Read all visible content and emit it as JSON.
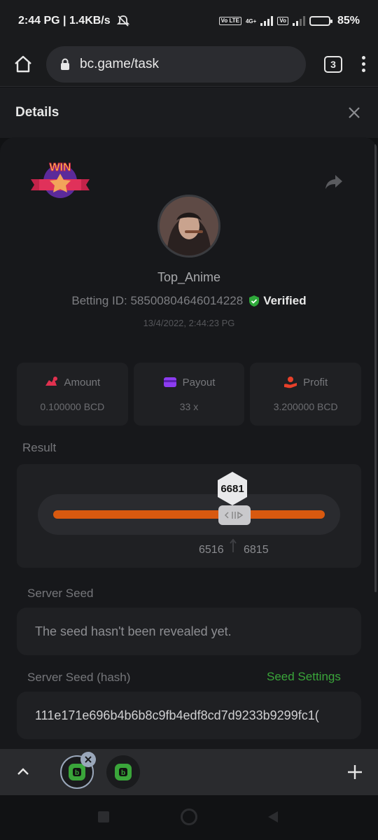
{
  "status": {
    "time_speed": "2:44 PG | 1.4KB/s",
    "net_tag_1": "Vo LTE",
    "net_tag_2": "4G+",
    "battery": "85%"
  },
  "browser": {
    "url": "bc.game/task",
    "tab_count": "3"
  },
  "header": {
    "title": "Details"
  },
  "bet": {
    "badge": "WIN",
    "username": "Top_Anime",
    "betting_id": "Betting ID: 58500804646014228",
    "verified": "Verified",
    "timestamp": "13/4/2022, 2:44:23 PG"
  },
  "stats": [
    {
      "label": "Amount",
      "value": "0.100000 BCD",
      "icon": "amount-icon",
      "color": "#e0314f"
    },
    {
      "label": "Payout",
      "value": "33 x",
      "icon": "payout-icon",
      "color": "#8c3cf0"
    },
    {
      "label": "Profit",
      "value": "3.200000 BCD",
      "icon": "profit-icon",
      "color": "#e8402a"
    }
  ],
  "result": {
    "label": "Result",
    "value": "6681",
    "range_low": "6516",
    "range_high": "6815",
    "bar_color": "#d8590f"
  },
  "server_seed": {
    "label": "Server Seed",
    "value": "The seed hasn't been revealed yet."
  },
  "server_seed_hash": {
    "label": "Server Seed (hash)",
    "settings_link": "Seed Settings",
    "value": "111e171e696b4b6b8c9fb4edf8cd7d9233b9299fc1("
  },
  "colors": {
    "verified_green": "#2ea83a",
    "link_green": "#3aa53a"
  }
}
